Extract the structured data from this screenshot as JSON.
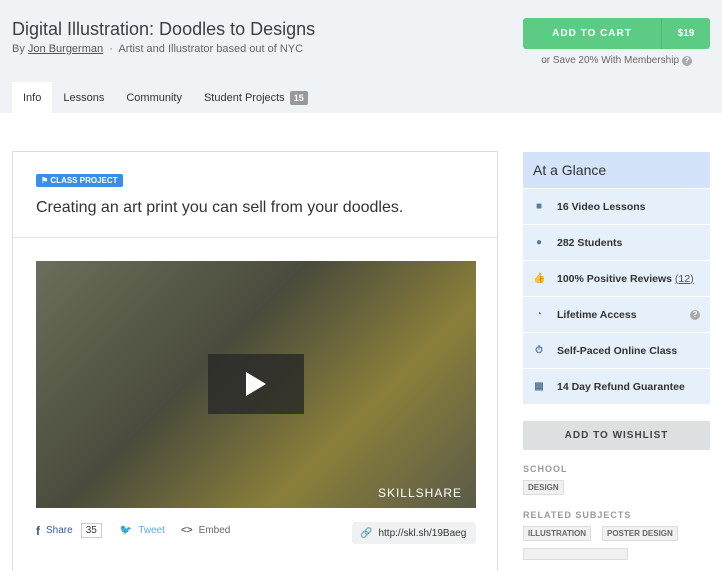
{
  "header": {
    "title": "Digital Illustration: Doodles to Designs",
    "by": "By",
    "author": "Jon Burgerman",
    "separator": "·",
    "author_desc": "Artist and Illustrator based out of NYC"
  },
  "cart": {
    "label": "ADD TO CART",
    "price": "$19",
    "save_text": "or Save 20% With Membership"
  },
  "tabs": [
    {
      "label": "Info"
    },
    {
      "label": "Lessons"
    },
    {
      "label": "Community"
    },
    {
      "label": "Student Projects",
      "badge": "15"
    }
  ],
  "project": {
    "badge": "CLASS PROJECT",
    "title": "Creating an art print you can sell from your doodles.",
    "watermark": "SKILLSHARE"
  },
  "share": {
    "share": "Share",
    "count": "35",
    "tweet": "Tweet",
    "embed": "Embed",
    "url": "http://skl.sh/19Baeg"
  },
  "glance": {
    "title": "At a Glance",
    "items": [
      {
        "icon": "video-icon",
        "label": "16 Video Lessons"
      },
      {
        "icon": "user-icon",
        "label": "282 Students"
      },
      {
        "icon": "thumbs-up-icon",
        "label": "100% Positive Reviews",
        "link": "(12)"
      },
      {
        "icon": "clock-icon",
        "label": "Lifetime Access"
      },
      {
        "icon": "stopwatch-icon",
        "label": "Self-Paced Online Class"
      },
      {
        "icon": "calendar-icon",
        "label": "14 Day Refund Guarantee"
      }
    ]
  },
  "wishlist": "ADD TO WISHLIST",
  "school": {
    "label": "SCHOOL",
    "tag": "DESIGN"
  },
  "related": {
    "label": "RELATED SUBJECTS",
    "tags": [
      "ILLUSTRATION",
      "POSTER DESIGN"
    ]
  }
}
